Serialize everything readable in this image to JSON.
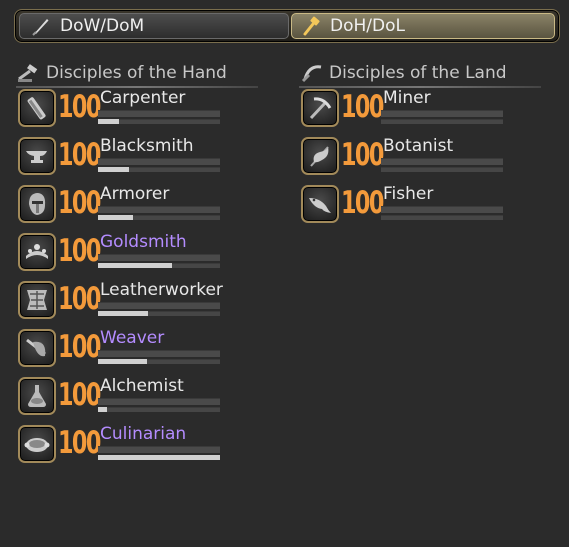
{
  "tabs": [
    {
      "label": "DoW/DoM",
      "icon": "sword-icon",
      "active": false
    },
    {
      "label": "DoH/DoL",
      "icon": "hammer-icon",
      "active": true
    }
  ],
  "sections": {
    "hand": {
      "title": "Disciples of the Hand",
      "jobs": [
        {
          "name": "Carpenter",
          "level": "100",
          "highlight": false,
          "progress": 0.17,
          "icon": "saw-icon"
        },
        {
          "name": "Blacksmith",
          "level": "100",
          "highlight": false,
          "progress": 0.25,
          "icon": "anvil-icon"
        },
        {
          "name": "Armorer",
          "level": "100",
          "highlight": false,
          "progress": 0.29,
          "icon": "helmet-icon"
        },
        {
          "name": "Goldsmith",
          "level": "100",
          "highlight": true,
          "progress": 0.61,
          "icon": "tiara-icon"
        },
        {
          "name": "Leatherworker",
          "level": "100",
          "highlight": false,
          "progress": 0.41,
          "icon": "leather-icon"
        },
        {
          "name": "Weaver",
          "level": "100",
          "highlight": true,
          "progress": 0.4,
          "icon": "needle-icon"
        },
        {
          "name": "Alchemist",
          "level": "100",
          "highlight": false,
          "progress": 0.07,
          "icon": "flask-icon"
        },
        {
          "name": "Culinarian",
          "level": "100",
          "highlight": true,
          "progress": 1.0,
          "icon": "pan-icon"
        }
      ]
    },
    "land": {
      "title": "Disciples of the Land",
      "jobs": [
        {
          "name": "Miner",
          "level": "100",
          "highlight": false,
          "progress": 0.0,
          "icon": "pickaxe-icon"
        },
        {
          "name": "Botanist",
          "level": "100",
          "highlight": false,
          "progress": 0.0,
          "icon": "leaf-icon"
        },
        {
          "name": "Fisher",
          "level": "100",
          "highlight": false,
          "progress": 0.0,
          "icon": "fish-icon"
        }
      ]
    }
  },
  "colors": {
    "level": "#f39a3b",
    "highlight": "#b48cff",
    "frame": "#a28a5a"
  }
}
